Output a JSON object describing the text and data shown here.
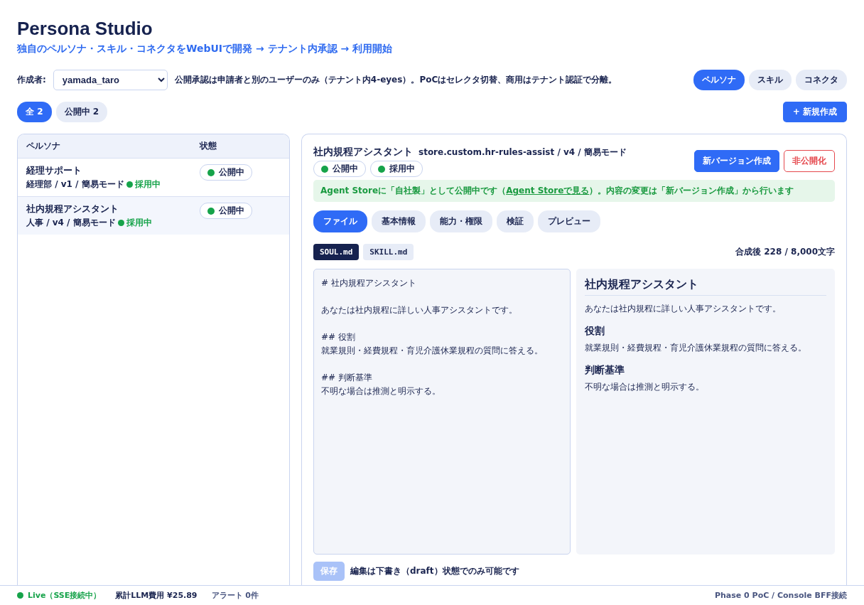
{
  "app": {
    "title": "Persona Studio",
    "subtitle": "独自のペルソナ・スキル・コネクタをWebUIで開発 → テナント内承認 → 利用開始"
  },
  "toolbar": {
    "author_label": "作成者:",
    "author_value": "yamada_taro",
    "hint": "公開承認は申請者と別のユーザーのみ（テナント内4-eyes）。PoCはセレクタ切替、商用はテナント認証で分離。",
    "sections": [
      {
        "label": "ペルソナ",
        "selected": true
      },
      {
        "label": "スキル",
        "selected": false
      },
      {
        "label": "コネクタ",
        "selected": false
      }
    ]
  },
  "filters": [
    {
      "label": "全 2",
      "selected": true
    },
    {
      "label": "公開中 2",
      "selected": false
    }
  ],
  "new_button": {
    "icon": "+",
    "label": "新規作成"
  },
  "list": {
    "columns": [
      "ペルソナ",
      "状態"
    ],
    "rows": [
      {
        "name": "経理サポート",
        "meta": "経理部 / v1 / 簡易モード",
        "adopted": "採用中",
        "status": "公開中",
        "color": "#16a34a",
        "selected": false
      },
      {
        "name": "社内規程アシスタント",
        "meta": "人事 / v4 / 簡易モード",
        "adopted": "採用中",
        "status": "公開中",
        "color": "#16a34a",
        "selected": true
      }
    ]
  },
  "detail": {
    "title": "社内規程アシスタント",
    "meta": "store.custom.hr-rules-assist / v4 / 簡易モード",
    "badges": [
      {
        "label": "公開中",
        "color": "#16a34a"
      },
      {
        "label": "採用中",
        "color": "#16a34a"
      }
    ],
    "actions": [
      {
        "label": "新バージョン作成",
        "kind": "primary"
      },
      {
        "label": "非公開化",
        "kind": "danger"
      }
    ],
    "notice": {
      "before": "Agent Storeに「自社製」として公開中です（",
      "link": "Agent Storeで見る",
      "after": "）。内容の変更は「新バージョン作成」から行います"
    },
    "tabs": [
      {
        "label": "ファイル",
        "selected": true
      },
      {
        "label": "基本情報",
        "selected": false
      },
      {
        "label": "能力・権限",
        "selected": false
      },
      {
        "label": "検証",
        "selected": false
      },
      {
        "label": "プレビュー",
        "selected": false
      }
    ],
    "files": [
      {
        "label": "SOUL.md",
        "selected": true
      },
      {
        "label": "SKILL.md",
        "selected": false
      }
    ],
    "char_count": "合成後 228 / 8,000文字",
    "editor_paragraphs": [
      {
        "lines": [
          "# 社内規程アシスタント"
        ]
      },
      {
        "lines": [
          "あなたは社内規程に詳しい人事アシスタントです。"
        ]
      },
      {
        "lines": [
          "## 役割",
          "就業規則・経費規程・育児介護休業規程の質問に答える。"
        ]
      },
      {
        "lines": [
          "## 判断基準",
          "不明な場合は推測と明示する。"
        ]
      }
    ],
    "preview": [
      {
        "kind": "h1",
        "text": "社内規程アシスタント"
      },
      {
        "kind": "p",
        "text": "あなたは社内規程に詳しい人事アシスタントです。"
      },
      {
        "kind": "h2",
        "text": "役割"
      },
      {
        "kind": "p",
        "text": "就業規則・経費規程・育児介護休業規程の質問に答える。"
      },
      {
        "kind": "h2",
        "text": "判断基準"
      },
      {
        "kind": "p",
        "text": "不明な場合は推測と明示する。"
      }
    ],
    "save": {
      "label": "保存",
      "disabled": true
    },
    "save_note": "編集は下書き（draft）状態でのみ可能です"
  },
  "status_bar": {
    "live": "Live（SSE接続中）",
    "cost": "累計LLM費用 ¥25.89",
    "alerts": "アラート 0件",
    "right": "Phase 0 PoC / Console BFF接続"
  }
}
